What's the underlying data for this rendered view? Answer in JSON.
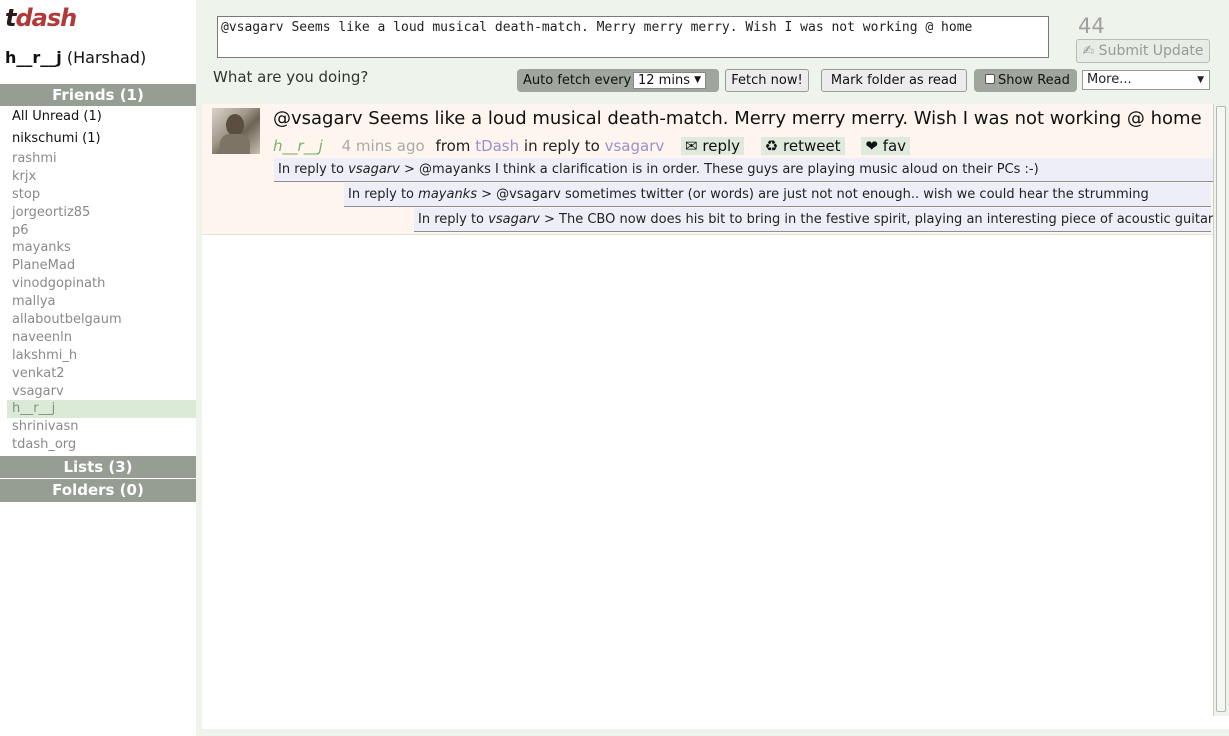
{
  "app": {
    "logo_t": "t",
    "logo_dash": "dash"
  },
  "user": {
    "handle": "h__r__j",
    "name": "(Harshad)"
  },
  "sidebar": {
    "friends_header": "Friends (1)",
    "lists_header": "Lists (3)",
    "folders_header": "Folders (0)",
    "items": [
      {
        "label": "All Unread (1)"
      },
      {
        "label": "nikschumi (1)"
      },
      {
        "label": "rashmi"
      },
      {
        "label": "krjx"
      },
      {
        "label": "stop"
      },
      {
        "label": "jorgeortiz85"
      },
      {
        "label": "p6"
      },
      {
        "label": "mayanks"
      },
      {
        "label": "PlaneMad"
      },
      {
        "label": "vinodgopinath"
      },
      {
        "label": "mallya"
      },
      {
        "label": "allaboutbelgaum"
      },
      {
        "label": "naveenln"
      },
      {
        "label": "lakshmi_h"
      },
      {
        "label": "venkat2"
      },
      {
        "label": "vsagarv"
      },
      {
        "label": "h__r__j"
      },
      {
        "label": "shrinivasn"
      },
      {
        "label": "tdash_org"
      }
    ]
  },
  "composer": {
    "text": "@vsagarv Seems like a loud musical death-match. Merry merry merry. Wish I was not working @ home",
    "char_count": "44",
    "submit_label": "✍ Submit Update",
    "prompt": "What are you doing?"
  },
  "toolbar": {
    "auto_fetch_label": "Auto fetch every",
    "interval_value": "12 mins",
    "fetch_now_label": "Fetch now!",
    "mark_read_label": "Mark folder as read",
    "show_read_label": "Show Read",
    "more_value": "More..."
  },
  "tweet": {
    "text": "@vsagarv Seems like a loud musical death-match. Merry merry merry. Wish I was not working @ home",
    "author": "h__r__j",
    "time": "4 mins ago",
    "from_label": "from",
    "source": "tDash",
    "in_reply_label": "in reply to",
    "in_reply_to": "vsagarv",
    "reply_label": "✉ reply",
    "retweet_label": "♻ retweet",
    "fav_label": "❤ fav"
  },
  "replies": [
    {
      "prefix": "In reply to",
      "who": "vsagarv",
      "text": "> @mayanks I think a clarification is in order. These guys are playing music aloud on their PCs :-)"
    },
    {
      "prefix": "In reply to",
      "who": "mayanks",
      "text": "> @vsagarv sometimes twitter (or words) are just not not enough.. wish we could hear the strumming"
    },
    {
      "prefix": "In reply to",
      "who": "vsagarv",
      "text": "> The CBO now does his bit to bring in the festive spirit, playing an interesting piece of acoustic guitar."
    }
  ],
  "icons": {
    "avatar": "user-avatar",
    "select_arrow": "chevron-down-icon"
  }
}
